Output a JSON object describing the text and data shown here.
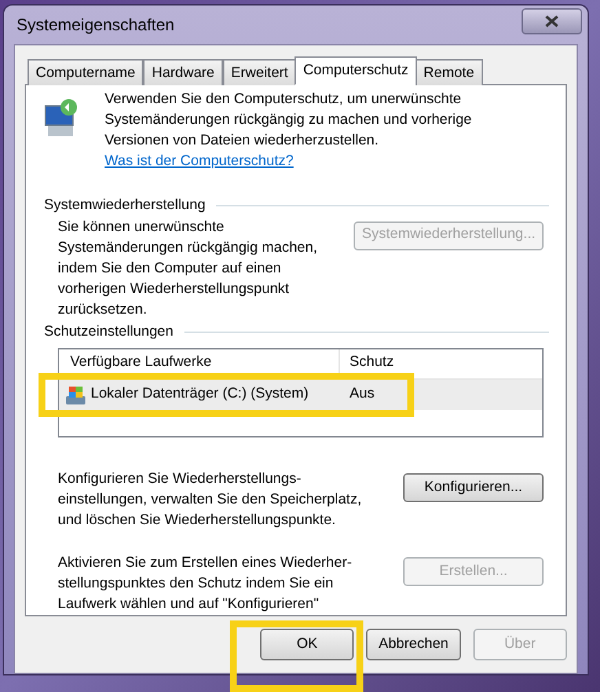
{
  "window": {
    "title": "Systemeigenschaften"
  },
  "tabs": [
    {
      "label": "Computername",
      "selected": false
    },
    {
      "label": "Hardware",
      "selected": false
    },
    {
      "label": "Erweitert",
      "selected": false
    },
    {
      "label": "Computerschutz",
      "selected": true
    },
    {
      "label": "Remote",
      "selected": false
    }
  ],
  "intro": {
    "text": "Verwenden Sie den Computerschutz, um unerwünschte Systemänderungen rückgängig zu machen und vorherige Versionen von Dateien wiederherzustellen.",
    "link": "Was ist der Computerschutz?"
  },
  "restore_group": {
    "title": "Systemwiederherstellung",
    "text": "Sie können unerwünschte Systemänderungen rückgängig machen, indem Sie den Computer auf einen vorherigen Wiederherstellungspunkt zurücksetzen.",
    "button": {
      "label": "Systemwiederherstellung...",
      "disabled": true
    }
  },
  "protection_group": {
    "title": "Schutzeinstellungen",
    "table": {
      "columns": [
        "Verfügbare Laufwerke",
        "Schutz"
      ],
      "rows": [
        {
          "drive": "Lokaler Datenträger (C:) (System)",
          "protection": "Aus",
          "selected": true
        }
      ]
    },
    "configure": {
      "text": "Konfigurieren Sie Wiederherstellungs-einstellungen, verwalten Sie den Speicherplatz, und löschen Sie Wiederherstellungspunkte.",
      "button": {
        "label": "Konfigurieren...",
        "disabled": false
      }
    },
    "create": {
      "text": "Aktivieren Sie zum Erstellen eines Wiederher-stellungspunktes den Schutz indem Sie ein Laufwerk wählen und auf \"Konfigurieren\"",
      "button": {
        "label": "Erstellen...",
        "disabled": true
      }
    }
  },
  "buttons": [
    {
      "label": "OK",
      "disabled": false
    },
    {
      "label": "Abbrechen",
      "disabled": false
    },
    {
      "label": "Über",
      "disabled": true
    }
  ]
}
